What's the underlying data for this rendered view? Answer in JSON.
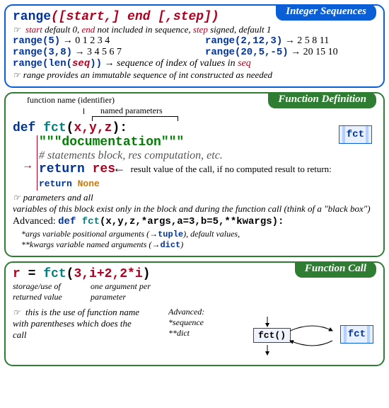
{
  "seq": {
    "title": "Integer Sequences",
    "sig_pre": "range",
    "sig_args": "([start,] end [,step])",
    "note1_a": "start",
    "note1_b": " default 0, ",
    "note1_c": "end",
    "note1_d": " not included in sequence, ",
    "note1_e": "step",
    "note1_f": " signed, default 1",
    "ex1a": "range(5)",
    "ex1b": "→ 0 1 2 3 4",
    "ex2a": "range(2,12,3)",
    "ex2b": "→ 2 5 8 11",
    "ex3a": "range(3,8)",
    "ex3b": "→ 3 4 5 6 7",
    "ex4a": "range(20,5,-5)",
    "ex4b": "→ 20 15 10",
    "ex5a": "range(len(",
    "ex5b": "seq",
    "ex5c": "))",
    "ex5d": "→ ",
    "ex5e": "sequence of index of values in ",
    "ex5f": "seq",
    "note2": "range provides an immutable sequence of int constructed as needed"
  },
  "def": {
    "title": "Function Definition",
    "ann_fn": "function name (identifier)",
    "ann_params": "named parameters",
    "line1_def": "def",
    "line1_fn": "fct",
    "line1_open": "(",
    "line1_args": "x,y,z",
    "line1_close": "):",
    "doc": "\"\"\"documentation\"\"\"",
    "stmts": "# statements block, res computation, etc.",
    "ret_kw": "return",
    "ret_val": "res",
    "ret_note_a": "result value of the call, if no computed result to return: ",
    "ret_note_b": "return None",
    "box": "fct",
    "scope": "parameters and all variables of this block exist only in the block and during the function call (think of a \"black box\")",
    "scope_a": "parameters and all",
    "scope_b": "variables of this block exist only ",
    "scope_c": "in",
    "scope_d": " the block and ",
    "scope_e": "during",
    "scope_f": " the function call (think of a \"black box\")",
    "adv_label": "Advanced: ",
    "adv_code_def": "def",
    "adv_code_fn": "fct",
    "adv_code_args": "(x,y,z,*args,a=3,b=5,**kwargs):",
    "adv_note1": "*args variable positional arguments (→",
    "adv_tuple": "tuple",
    "adv_note1b": "), default values,",
    "adv_note2": "**kwargs variable named arguments (→",
    "adv_dict": "dict",
    "adv_note2b": ")"
  },
  "call": {
    "title": "Function Call",
    "line_r": "r",
    "line_eq": " = ",
    "line_fn": "fct",
    "line_open": "(",
    "line_args": "3,i+2,2*i",
    "line_close": ")",
    "ann1": "storage/use of returned value",
    "ann2": "one argument per parameter",
    "note": "this is the use of function name with parentheses which does the call",
    "note_a": "this is the use of function name ",
    "note_b": "with parentheses",
    "note_c": " which does the call",
    "adv_label": "Advanced:",
    "adv1": "*sequence",
    "adv2": "**dict",
    "box_call": "fct()",
    "box_def": "fct"
  }
}
